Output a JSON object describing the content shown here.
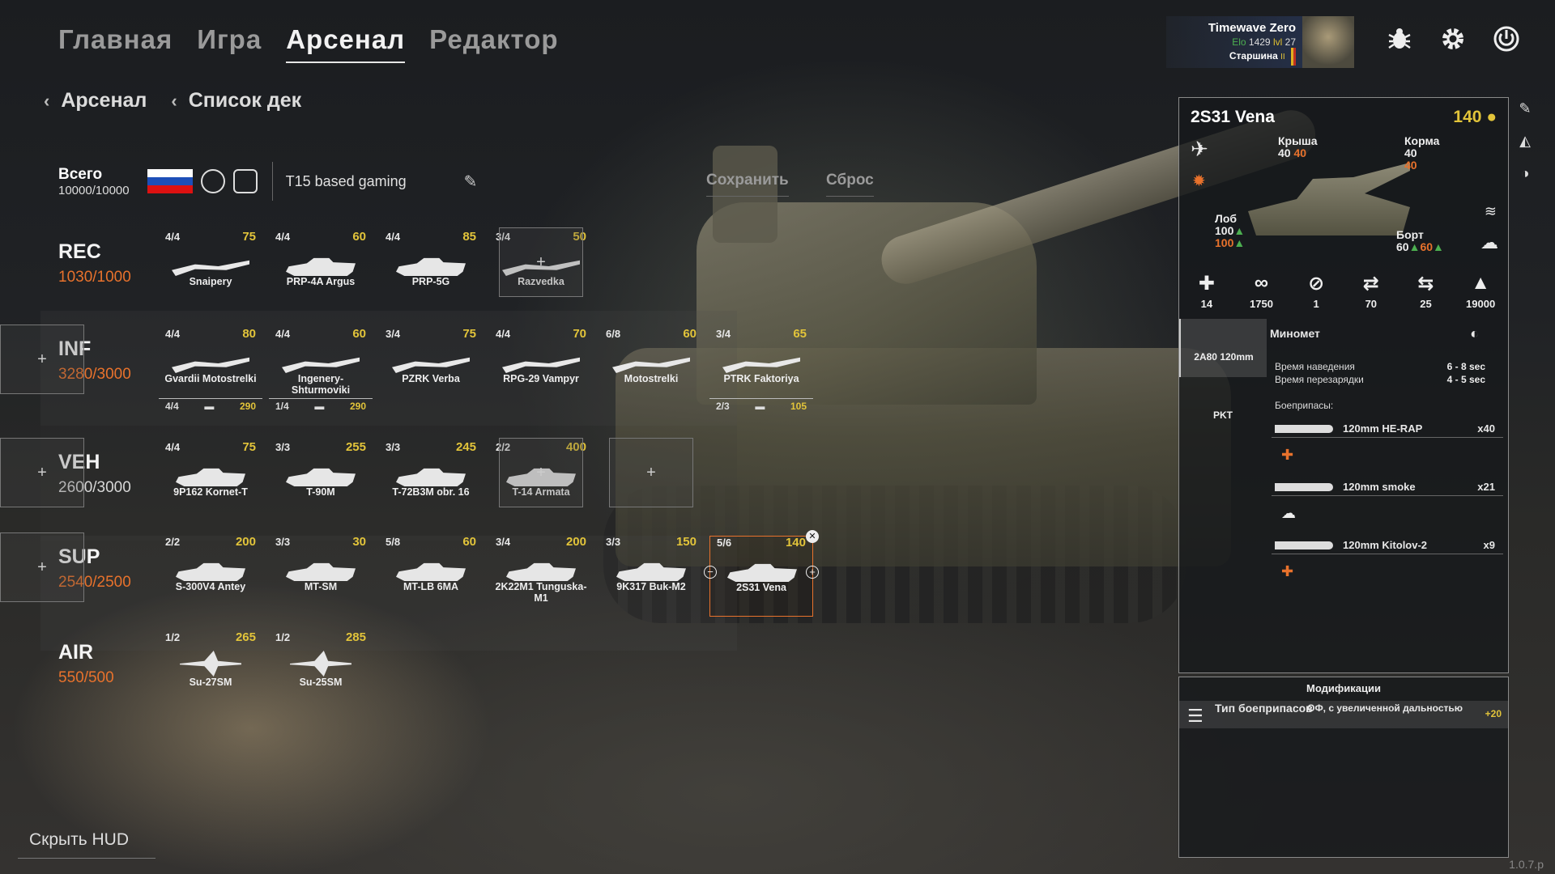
{
  "nav": {
    "tabs": [
      "Главная",
      "Игра",
      "Арсенал",
      "Редактор"
    ],
    "active": "Арсенал"
  },
  "breadcrumb": [
    "Арсенал",
    "Список дек"
  ],
  "user": {
    "name": "Timewave Zero",
    "elo_label": "Elo",
    "elo": "1429",
    "lvl_label": "lvl",
    "lvl": "27",
    "rank": "Старшина",
    "rank_roman": "II"
  },
  "deck": {
    "total_label": "Всего",
    "total_value": "10000/10000",
    "name": "T15 based gaming",
    "save": "Сохранить",
    "reset": "Сброс"
  },
  "categories": [
    {
      "id": "REC",
      "name": "REC",
      "points": "1030/1000",
      "over": true,
      "units": [
        {
          "avail": "4/4",
          "cost": "75",
          "name": "Snaipery",
          "kind": "inf"
        },
        {
          "avail": "4/4",
          "cost": "60",
          "name": "PRP-4A Argus",
          "kind": "veh"
        },
        {
          "avail": "4/4",
          "cost": "85",
          "name": "PRP-5G",
          "kind": "veh"
        },
        {
          "avail": "3/4",
          "cost": "50",
          "name": "Razvedka",
          "kind": "inf"
        }
      ]
    },
    {
      "id": "INF",
      "name": "INF",
      "points": "3280/3000",
      "over": true,
      "units": [
        {
          "avail": "4/4",
          "cost": "80",
          "name": "Gvardii Motostrelki",
          "kind": "inf",
          "sub_avail": "4/4",
          "sub_cost": "290"
        },
        {
          "avail": "4/4",
          "cost": "60",
          "name": "Ingenery-Shturmoviki",
          "kind": "inf",
          "sub_avail": "1/4",
          "sub_cost": "290"
        },
        {
          "avail": "3/4",
          "cost": "75",
          "name": "PZRK Verba",
          "kind": "inf"
        },
        {
          "avail": "4/4",
          "cost": "70",
          "name": "RPG-29 Vampyr",
          "kind": "inf"
        },
        {
          "avail": "6/8",
          "cost": "60",
          "name": "Motostrelki",
          "kind": "inf"
        },
        {
          "avail": "3/4",
          "cost": "65",
          "name": "PTRK Faktoriya",
          "kind": "inf",
          "sub_avail": "2/3",
          "sub_cost": "105"
        }
      ]
    },
    {
      "id": "VEH",
      "name": "VEH",
      "points": "2600/3000",
      "over": false,
      "units": [
        {
          "avail": "4/4",
          "cost": "75",
          "name": "9P162 Kornet-T",
          "kind": "veh"
        },
        {
          "avail": "3/3",
          "cost": "255",
          "name": "T-90M",
          "kind": "veh"
        },
        {
          "avail": "3/3",
          "cost": "245",
          "name": "T-72B3M obr. 16",
          "kind": "veh"
        },
        {
          "avail": "2/2",
          "cost": "400",
          "name": "T-14 Armata",
          "kind": "veh"
        }
      ]
    },
    {
      "id": "SUP",
      "name": "SUP",
      "points": "2540/2500",
      "over": true,
      "units": [
        {
          "avail": "2/2",
          "cost": "200",
          "name": "S-300V4 Antey",
          "kind": "veh"
        },
        {
          "avail": "3/3",
          "cost": "30",
          "name": "MT-SM",
          "kind": "veh"
        },
        {
          "avail": "5/8",
          "cost": "60",
          "name": "MT-LB 6MA",
          "kind": "veh"
        },
        {
          "avail": "3/4",
          "cost": "200",
          "name": "2K22M1 Tunguska-M1",
          "kind": "veh"
        },
        {
          "avail": "3/3",
          "cost": "150",
          "name": "9K317 Buk-M2",
          "kind": "veh"
        },
        {
          "avail": "5/6",
          "cost": "140",
          "name": "2S31 Vena",
          "kind": "veh",
          "selected": true
        }
      ]
    },
    {
      "id": "AIR",
      "name": "AIR",
      "points": "550/500",
      "over": true,
      "units": [
        {
          "avail": "1/2",
          "cost": "265",
          "name": "Su-27SM",
          "kind": "air"
        },
        {
          "avail": "1/2",
          "cost": "285",
          "name": "Su-25SM",
          "kind": "air"
        }
      ]
    }
  ],
  "slot_label": "+",
  "panel": {
    "title": "2S31 Vena",
    "cost": "140",
    "roof_label": "Крыша",
    "roof": "40",
    "roof_mod": "40",
    "rear_label": "Корма",
    "rear": "40",
    "rear_mod": "40",
    "front_label": "Лоб",
    "front": "100",
    "front_mod": "100",
    "side_label": "Борт",
    "side": "60",
    "side_mod": "60",
    "stats": [
      {
        "icon": "shield-icon",
        "glyph": "✚",
        "value": "14"
      },
      {
        "icon": "binoculars-icon",
        "glyph": "∞",
        "value": "1750"
      },
      {
        "icon": "stealth-icon",
        "glyph": "⊘",
        "value": "1"
      },
      {
        "icon": "road-speed-icon",
        "glyph": "⇄",
        "value": "70"
      },
      {
        "icon": "offroad-speed-icon",
        "glyph": "⇆",
        "value": "25"
      },
      {
        "icon": "weight-icon",
        "glyph": "▲",
        "value": "19000"
      }
    ],
    "weapons": [
      "2A80 120mm",
      "PKT"
    ],
    "weapon": {
      "name": "Миномет",
      "aim_label": "Время наведения",
      "aim": "6 - 8 sec",
      "reload_label": "Время перезарядки",
      "reload": "4 - 5 sec",
      "ammo_label": "Боеприпасы:",
      "ammo": [
        {
          "name": "120mm HE-RAP",
          "count": "x40"
        },
        {
          "name": "120mm smoke",
          "count": "x21"
        },
        {
          "name": "120mm Kitolov-2",
          "count": "x9"
        }
      ]
    }
  },
  "mods": {
    "title": "Модификации",
    "type": "Тип боеприпасов",
    "value": "ОФ, с увеличенной дальностью",
    "bonus": "+20"
  },
  "hide_hud": "Скрыть HUD",
  "version": "1.0.7.p",
  "colors": {
    "over": "#e8722c",
    "cost": "#e2c43a",
    "ok": "#4caf50"
  }
}
